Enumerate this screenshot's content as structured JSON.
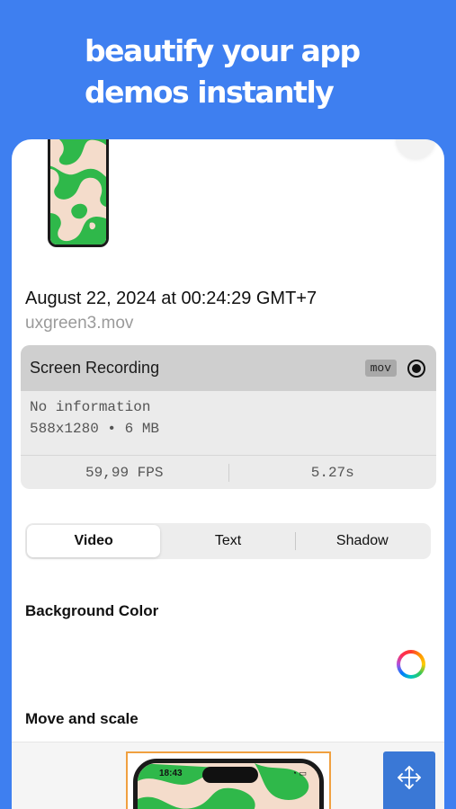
{
  "headline": {
    "line1": "beautify your app",
    "line2": "demos instantly"
  },
  "video": {
    "date": "August 22, 2024 at 00:24:29 GMT+7",
    "filename": "uxgreen3.mov"
  },
  "info_card": {
    "title": "Screen Recording",
    "badge": "mov",
    "description": "No information",
    "details": "588x1280 • 6 MB",
    "fps": "59,99 FPS",
    "duration": "5.27s"
  },
  "tabs": [
    {
      "label": "Video",
      "active": true
    },
    {
      "label": "Text",
      "active": false
    },
    {
      "label": "Shadow",
      "active": false
    }
  ],
  "sections": {
    "background_color": "Background Color",
    "move_and_scale": "Move and scale"
  },
  "preview": {
    "status_time": "18:43"
  },
  "colors": {
    "brand_blue": "#3e7ff0",
    "pattern_green": "#2fb84a",
    "pattern_cream": "#f4dccb",
    "selection_orange": "#f0a040"
  },
  "icons": {
    "record": "record-icon",
    "color_picker": "color-wheel-icon",
    "move": "move-arrows-icon",
    "close": "close-icon"
  }
}
